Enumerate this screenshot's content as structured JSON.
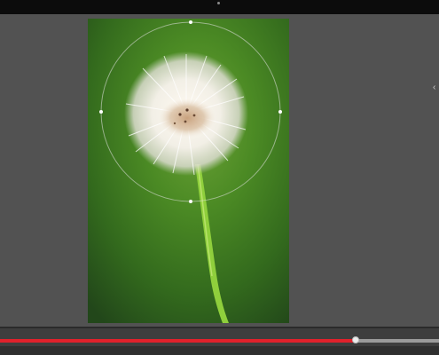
{
  "window": {
    "title": ""
  },
  "image": {
    "subject": "dandelion-seed-head",
    "background_color": "#3f7a22"
  },
  "selection": {
    "shape": "circle",
    "handles": [
      "top",
      "right",
      "bottom",
      "left"
    ],
    "stroke_color": "#d8d8d8"
  },
  "timeline": {
    "progress": 0.81,
    "fill_color": "#e0212b",
    "track_color": "#9a9a9a"
  },
  "icons": {
    "right_edge": "chevron-handle-icon"
  }
}
